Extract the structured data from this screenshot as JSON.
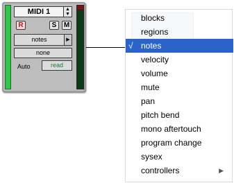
{
  "track": {
    "name": "MIDI 1",
    "record_label": "R",
    "solo_label": "S",
    "mute_label": "M",
    "view_value": "notes",
    "channel_value": "none",
    "automation_label": "Auto",
    "automation_mode": "read",
    "color": "#33c44a"
  },
  "menu": {
    "items": [
      {
        "label": "blocks",
        "checked": false,
        "submenu": false
      },
      {
        "label": "regions",
        "checked": false,
        "submenu": false
      },
      {
        "label": "notes",
        "checked": true,
        "submenu": false,
        "check_mark": "√"
      },
      {
        "label": "velocity",
        "checked": false,
        "submenu": false
      },
      {
        "label": "volume",
        "checked": false,
        "submenu": false
      },
      {
        "label": "mute",
        "checked": false,
        "submenu": false
      },
      {
        "label": "pan",
        "checked": false,
        "submenu": false
      },
      {
        "label": "pitch bend",
        "checked": false,
        "submenu": false
      },
      {
        "label": "mono aftertouch",
        "checked": false,
        "submenu": false
      },
      {
        "label": "program change",
        "checked": false,
        "submenu": false
      },
      {
        "label": "sysex",
        "checked": false,
        "submenu": false
      },
      {
        "label": "controllers",
        "checked": false,
        "submenu": true,
        "submenu_icon": "▶"
      }
    ],
    "highlight_color": "#2a63c9"
  }
}
